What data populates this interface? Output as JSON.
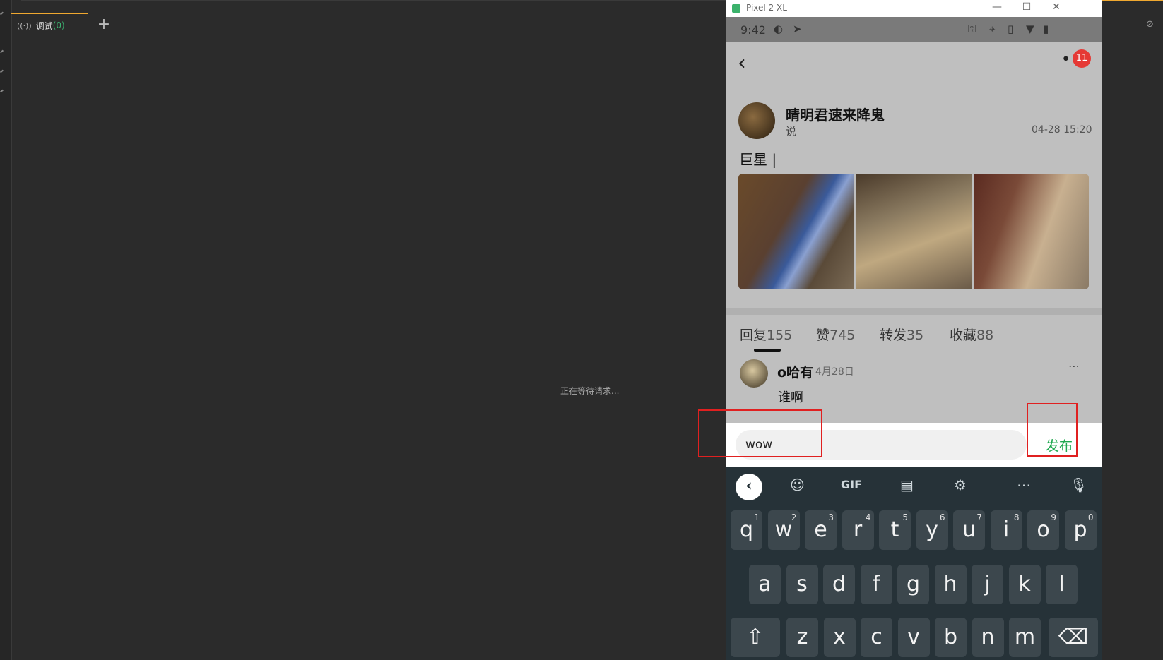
{
  "debugger": {
    "tab_label": "调试",
    "tab_count": "(0)",
    "tab_icon": "broadcast-icon",
    "add_tab": "+",
    "waiting_text": "正在等待请求..."
  },
  "emulator": {
    "window_title": "Pixel 2 XL",
    "window_buttons": [
      "—",
      "☐",
      "✕"
    ],
    "status": {
      "time": "9:42"
    },
    "notification_badge": "11",
    "post": {
      "author": "晴明君速来降鬼",
      "verb": "说",
      "date": "04-28 15:20",
      "text": "巨星 |"
    },
    "tabs": [
      {
        "label": "回复",
        "count": "155"
      },
      {
        "label": "赞",
        "count": "745"
      },
      {
        "label": "转发",
        "count": "35"
      },
      {
        "label": "收藏",
        "count": "88"
      }
    ],
    "comment": {
      "author": "o哈有",
      "date": "4月28日",
      "text": "谁啊",
      "more": "⋯"
    },
    "input": {
      "value": "wow"
    },
    "publish_label": "发布"
  },
  "keyboard": {
    "toolbar": [
      "sticker-icon",
      "GIF",
      "clipboard-icon",
      "gear-icon",
      "⋯",
      "mic-icon"
    ],
    "row1": [
      {
        "k": "q",
        "h": "1"
      },
      {
        "k": "w",
        "h": "2"
      },
      {
        "k": "e",
        "h": "3"
      },
      {
        "k": "r",
        "h": "4"
      },
      {
        "k": "t",
        "h": "5"
      },
      {
        "k": "y",
        "h": "6"
      },
      {
        "k": "u",
        "h": "7"
      },
      {
        "k": "i",
        "h": "8"
      },
      {
        "k": "o",
        "h": "9"
      },
      {
        "k": "p",
        "h": "0"
      }
    ],
    "row2": [
      "a",
      "s",
      "d",
      "f",
      "g",
      "h",
      "j",
      "k",
      "l"
    ],
    "row3": [
      "z",
      "x",
      "c",
      "v",
      "b",
      "n",
      "m"
    ]
  },
  "colors": {
    "accent_orange": "#f0a830",
    "publish_green": "#1fa84f",
    "badge_red": "#e53935",
    "annotation_red": "#e02020"
  }
}
